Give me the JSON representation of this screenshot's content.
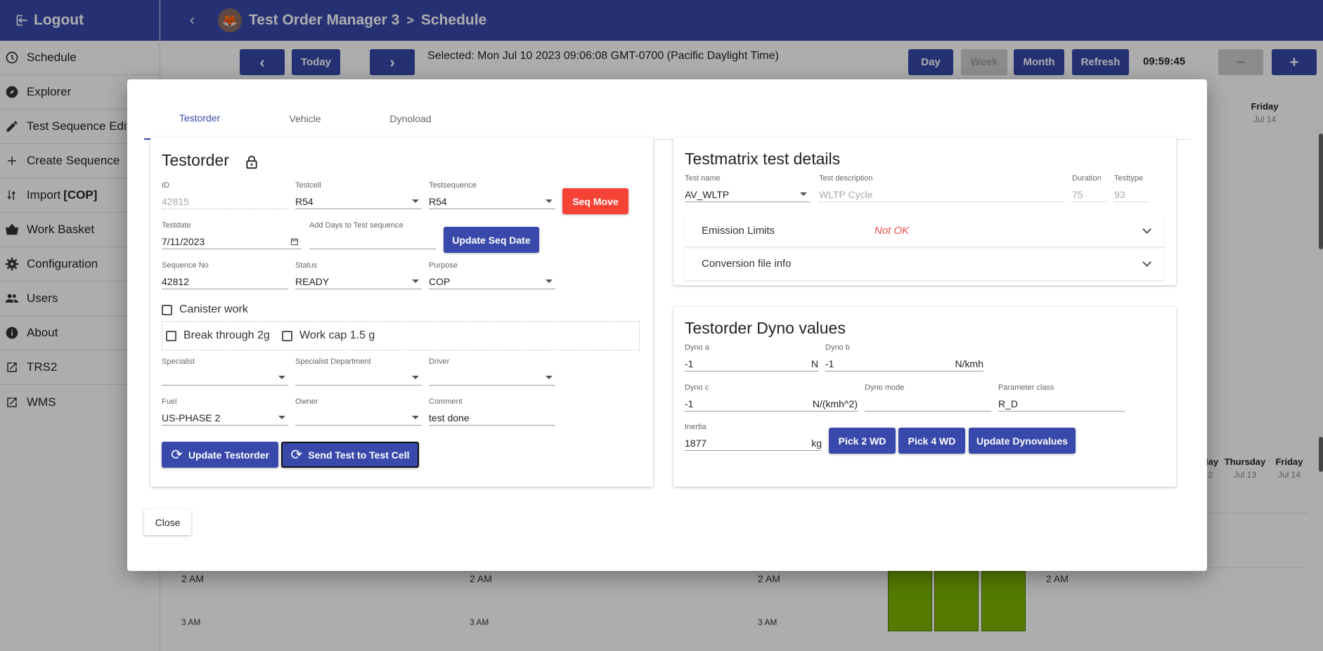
{
  "sidebar": {
    "logout_label": "Logout",
    "items": [
      {
        "label": "Schedule",
        "icon": "clock-icon"
      },
      {
        "label": "Explorer",
        "icon": "compass-icon"
      },
      {
        "label": "Test Sequence Editor",
        "icon": "pencil-icon"
      },
      {
        "label": "Create Sequence",
        "icon": "plus-icon"
      },
      {
        "label": "Import",
        "bold": "[COP]",
        "icon": "import-icon"
      },
      {
        "label": "Work Basket",
        "icon": "basket-icon"
      },
      {
        "label": "Configuration",
        "icon": "gear-icon"
      },
      {
        "label": "Users",
        "icon": "users-icon"
      },
      {
        "label": "About",
        "icon": "info-icon"
      },
      {
        "label": "TRS2",
        "icon": "external-link-icon"
      },
      {
        "label": "WMS",
        "icon": "external-link-icon"
      }
    ]
  },
  "header": {
    "app_title": "Test Order Manager 3",
    "separator": ">",
    "page_title": "Schedule"
  },
  "toolbar": {
    "prev": "‹",
    "today": "Today",
    "next": "›",
    "selected_text": "Selected: Mon Jul 10 2023 09:06:08 GMT-0700 (Pacific Daylight Time)",
    "day": "Day",
    "week": "Week",
    "month": "Month",
    "refresh": "Refresh",
    "clock": "09:59:45",
    "zoom_out": "−",
    "zoom_in": "+"
  },
  "calendar": {
    "heads": [
      {
        "day": "Friday",
        "date": "Jul 14"
      },
      {
        "day": "day",
        "date": "2"
      },
      {
        "day": "Thursday",
        "date": "Jul 13"
      },
      {
        "day": "Friday",
        "date": "Jul 14"
      }
    ],
    "hour_label": "2 AM",
    "hour_label_cut": "3 AM"
  },
  "modal": {
    "tabs": [
      "Testorder",
      "Vehicle",
      "Dynoload"
    ],
    "testorder": {
      "title": "Testorder",
      "id_label": "ID",
      "id_value": "42815",
      "testcell_label": "Testcell",
      "testcell_value": "R54",
      "testsequence_label": "Testsequence",
      "testsequence_value": "R54",
      "seq_move": "Seq Move",
      "testdate_label": "Testdate",
      "testdate_value": "7/11/2023",
      "add_days_label": "Add Days to Test sequence",
      "add_days_value": "",
      "update_seq_date": "Update Seq Date",
      "sequence_no_label": "Sequence No",
      "sequence_no_value": "42812",
      "status_label": "Status",
      "status_value": "READY",
      "purpose_label": "Purpose",
      "purpose_value": "COP",
      "canister_work": "Canister work",
      "break_through": "Break through 2g",
      "work_cap": "Work cap 1.5 g",
      "specialist_label": "Specialist",
      "specialist_value": "",
      "specialist_dept_label": "Specialist Department",
      "specialist_dept_value": "",
      "driver_label": "Driver",
      "driver_value": "",
      "fuel_label": "Fuel",
      "fuel_value": "US-PHASE 2",
      "owner_label": "Owner",
      "owner_value": "",
      "comment_label": "Comment",
      "comment_value": "test done",
      "update_testorder": "Update Testorder",
      "send_test": "Send Test to Test Cell"
    },
    "testmatrix": {
      "title": "Testmatrix test details",
      "test_name_label": "Test name",
      "test_name_value": "AV_WLTP",
      "test_desc_label": "Test description",
      "test_desc_value": "WLTP Cycle",
      "duration_label": "Duration",
      "duration_value": "75",
      "testtype_label": "Testtype",
      "testtype_value": "93",
      "emission_limits": "Emission Limits",
      "emission_status": "Not OK",
      "conversion_info": "Conversion file info"
    },
    "dyno": {
      "title": "Testorder Dyno values",
      "dyno_a_label": "Dyno a",
      "dyno_a_value": "-1",
      "dyno_a_unit": "N",
      "dyno_b_label": "Dyno b",
      "dyno_b_value": "-1",
      "dyno_b_unit": "N/kmh",
      "dyno_c_label": "Dyno c",
      "dyno_c_value": "-1",
      "dyno_c_unit": "N/(kmh^2)",
      "dyno_mode_label": "Dyno mode",
      "dyno_mode_value": "",
      "param_class_label": "Parameter class",
      "param_class_value": "R_D",
      "inertia_label": "Inertia",
      "inertia_value": "1877",
      "inertia_unit": "kg",
      "pick_2wd": "Pick 2 WD",
      "pick_4wd": "Pick 4 WD",
      "update_dyno": "Update Dynovalues"
    },
    "close": "Close"
  }
}
